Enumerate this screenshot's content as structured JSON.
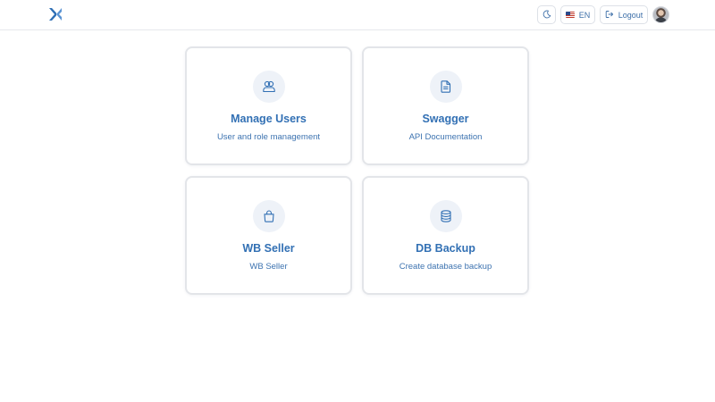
{
  "header": {
    "language_label": "EN",
    "logout_label": "Logout"
  },
  "cards": [
    {
      "title": "Manage Users",
      "description": "User and role management",
      "icon": "users-icon"
    },
    {
      "title": "Swagger",
      "description": "API Documentation",
      "icon": "document-icon"
    },
    {
      "title": "WB Seller",
      "description": "WB Seller",
      "icon": "shopping-bag-icon"
    },
    {
      "title": "DB Backup",
      "description": "Create database backup",
      "icon": "database-icon"
    }
  ],
  "colors": {
    "accent": "#3270b4",
    "icon_bg": "#eef2f8",
    "border": "#e3e5e9"
  }
}
